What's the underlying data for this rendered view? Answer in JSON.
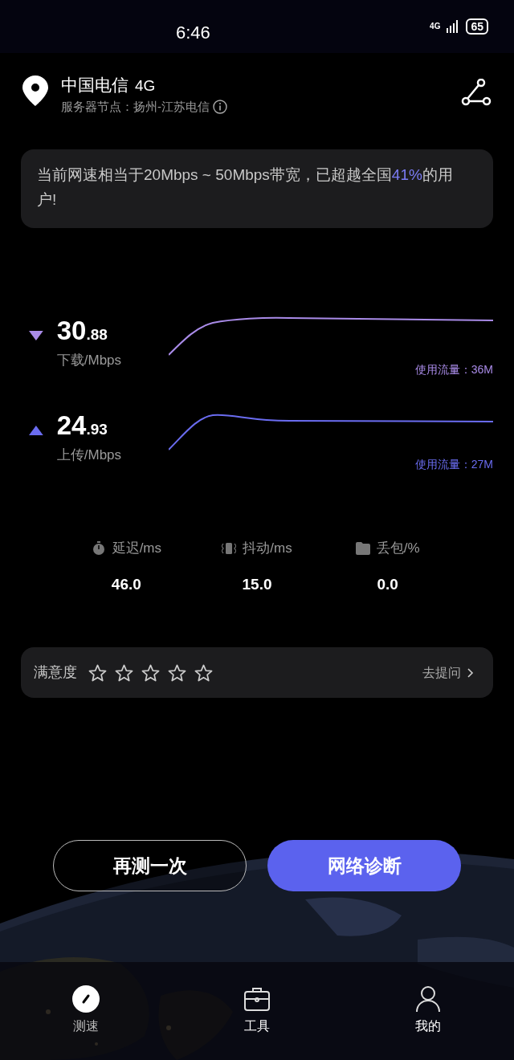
{
  "status_bar": {
    "time": "6:46",
    "network": "4G",
    "battery": "65"
  },
  "header": {
    "carrier": "中国电信",
    "network": "4G",
    "server": "服务器节点：扬州-江苏电信"
  },
  "summary": {
    "before": "当前网速相当于20Mbps ~ 50Mbps带宽，已超越全国",
    "highlight": "41%",
    "after": "的用户!"
  },
  "speeds": [
    {
      "kind": "download",
      "integer": "30",
      "decimal": ".88",
      "label": "下载/Mbps",
      "usage": "使用流量：36M",
      "color": "#a98be8"
    },
    {
      "kind": "upload",
      "integer": "24",
      "decimal": ".93",
      "label": "上传/Mbps",
      "usage": "使用流量：27M",
      "color": "#6a6cf0"
    }
  ],
  "metrics": [
    {
      "kind": "latency",
      "label": "延迟/ms",
      "value": "46.0"
    },
    {
      "kind": "jitter",
      "label": "抖动/ms",
      "value": "15.0"
    },
    {
      "kind": "loss",
      "label": "丢包/%",
      "value": "0.0"
    }
  ],
  "rating": {
    "label": "满意度",
    "stars": 0,
    "link": "去提问"
  },
  "buttons": [
    {
      "kind": "outline",
      "label": "再测一次"
    },
    {
      "kind": "primary",
      "label": "网络诊断"
    }
  ],
  "tabs": [
    {
      "kind": "speed",
      "label": "测速",
      "selected": true
    },
    {
      "kind": "tools",
      "label": "工具",
      "selected": false
    },
    {
      "kind": "me",
      "label": "我的",
      "selected": false
    }
  ]
}
